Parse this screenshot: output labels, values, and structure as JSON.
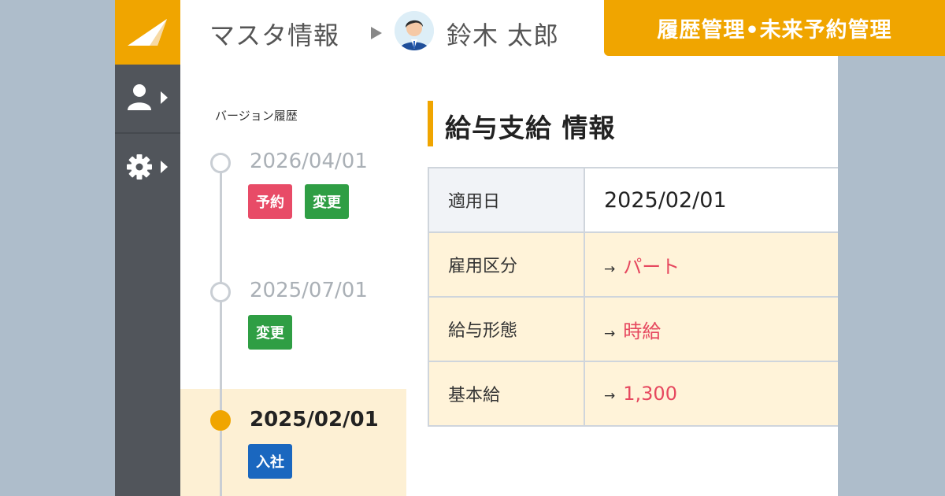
{
  "header": {
    "breadcrumb_title": "マスタ情報",
    "user_name": "鈴木 太郎"
  },
  "banner": {
    "text": "履歴管理•未来予約管理"
  },
  "sidebar": {
    "items": [
      {
        "icon": "user-icon"
      },
      {
        "icon": "gear-icon"
      }
    ]
  },
  "timeline": {
    "heading": "バージョン履歴",
    "versions": [
      {
        "date": "2026/04/01",
        "tags": [
          "予約",
          "変更"
        ]
      },
      {
        "date": "2025/07/01",
        "tags": [
          "変更"
        ]
      },
      {
        "date": "2025/02/01",
        "tags": [
          "入社"
        ],
        "selected": true
      }
    ]
  },
  "detail": {
    "section_title": "給与支給 情報",
    "rows": [
      {
        "key": "適用日",
        "value": "2025/02/01"
      },
      {
        "key": "雇用区分",
        "arrow": "→",
        "value": "パート"
      },
      {
        "key": "給与形態",
        "arrow": "→",
        "value": "時給"
      },
      {
        "key": "基本給",
        "arrow": "→",
        "value": "1,300"
      }
    ]
  },
  "colors": {
    "accent": "#f0a500",
    "sidebar": "#51555b",
    "tag_reserve": "#e84b67",
    "tag_change": "#2f9e44",
    "tag_join": "#1a67bf",
    "changed_value": "#e6485f"
  }
}
